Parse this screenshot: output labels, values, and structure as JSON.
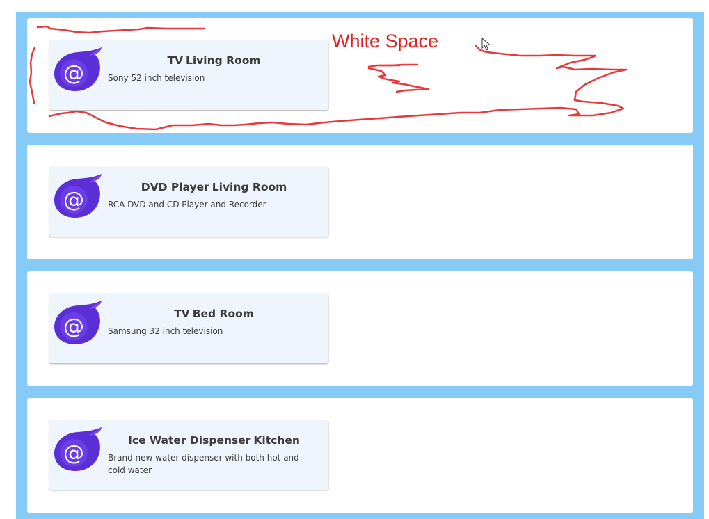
{
  "cards": [
    {
      "title": "TV",
      "location": "Living Room",
      "description": "Sony 52 inch television",
      "icon": "blazor-logo-icon"
    },
    {
      "title": "DVD Player",
      "location": "Living Room",
      "description": "RCA DVD and CD Player and Recorder",
      "icon": "blazor-logo-icon"
    },
    {
      "title": "TV",
      "location": "Bed Room",
      "description": "Samsung 32 inch television",
      "icon": "blazor-logo-icon"
    },
    {
      "title": "Ice Water Dispenser",
      "location": "Kitchen",
      "description": "Brand new water dispenser with both hot and cold water",
      "icon": "blazor-logo-icon"
    }
  ],
  "annotation": {
    "label": "White Space",
    "color": "#e02020"
  },
  "colors": {
    "page_background": "#86cbf8",
    "panel_background": "#ffffff",
    "card_background": "#eef5fd",
    "logo_purple": "#5b2fd6",
    "title_text": "#3b3b3b"
  }
}
